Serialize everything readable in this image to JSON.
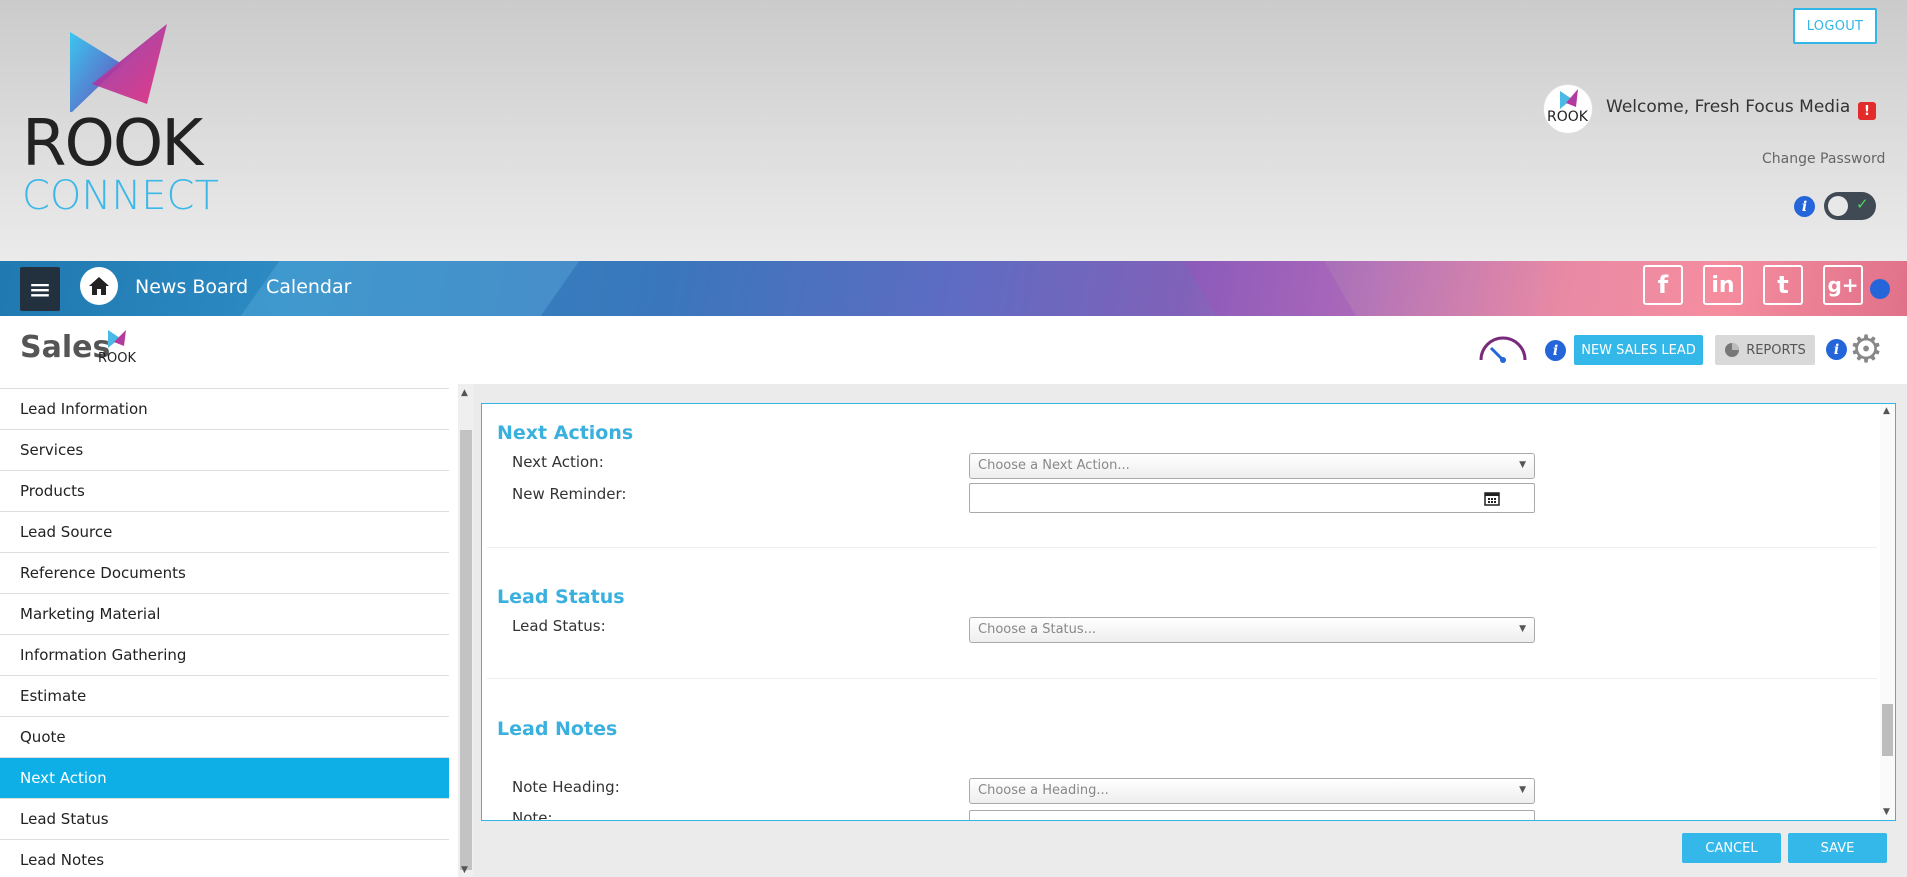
{
  "header": {
    "logo_line1": "ROOK",
    "logo_line2": "CONNECT",
    "logout_label": "LOGOUT",
    "welcome_text": "Welcome, Fresh Focus Media",
    "change_password": "Change Password",
    "alert_glyph": "!",
    "avatar_text": "ROOK"
  },
  "nav": {
    "items": [
      "News Board",
      "Calendar"
    ],
    "social": [
      "f",
      "in",
      "t",
      "g+"
    ]
  },
  "sales": {
    "title": "Sales",
    "new_lead_label": "NEW SALES LEAD",
    "reports_label": "REPORTS"
  },
  "sidebar": {
    "items": [
      "Lead Information",
      "Services",
      "Products",
      "Lead Source",
      "Reference Documents",
      "Marketing Material",
      "Information Gathering",
      "Estimate",
      "Quote",
      "Next Action",
      "Lead Status",
      "Lead Notes"
    ],
    "active": "Next Action"
  },
  "form": {
    "next_actions": {
      "title": "Next Actions",
      "next_action_label": "Next Action:",
      "next_action_placeholder": "Choose a Next Action...",
      "new_reminder_label": "New Reminder:"
    },
    "lead_status": {
      "title": "Lead Status",
      "label": "Lead Status:",
      "placeholder": "Choose a Status..."
    },
    "lead_notes": {
      "title": "Lead Notes",
      "note_heading_label": "Note Heading:",
      "note_heading_placeholder": "Choose a Heading...",
      "note_label": "Note:"
    }
  },
  "footer": {
    "cancel_label": "CANCEL",
    "save_label": "SAVE"
  },
  "colors": {
    "accent": "#33b8e9",
    "active_item": "#0eaee6",
    "info_icon": "#2466d9",
    "alert": "#e42b2b"
  }
}
